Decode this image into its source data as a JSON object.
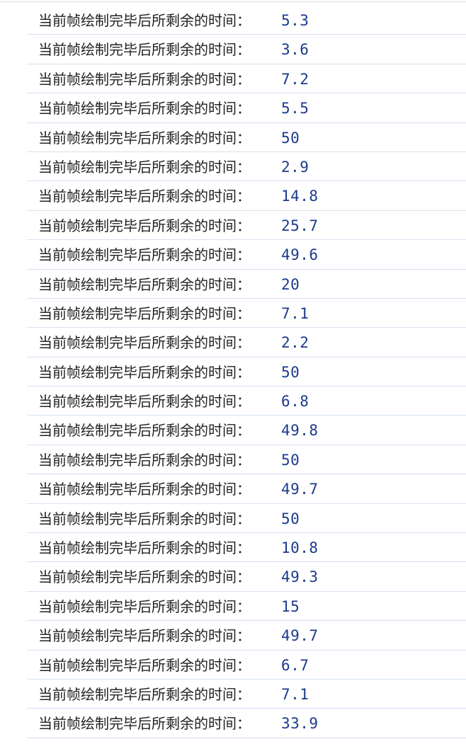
{
  "console": {
    "label": "当前帧绘制完毕后所剩余的时间：",
    "rows": [
      {
        "value": "5.3"
      },
      {
        "value": "3.6"
      },
      {
        "value": "7.2"
      },
      {
        "value": "5.5"
      },
      {
        "value": "50"
      },
      {
        "value": "2.9"
      },
      {
        "value": "14.8"
      },
      {
        "value": "25.7"
      },
      {
        "value": "49.6"
      },
      {
        "value": "20"
      },
      {
        "value": "7.1"
      },
      {
        "value": "2.2"
      },
      {
        "value": "50"
      },
      {
        "value": "6.8"
      },
      {
        "value": "49.8"
      },
      {
        "value": "50"
      },
      {
        "value": "49.7"
      },
      {
        "value": "50"
      },
      {
        "value": "10.8"
      },
      {
        "value": "49.3"
      },
      {
        "value": "15"
      },
      {
        "value": "49.7"
      },
      {
        "value": "6.7"
      },
      {
        "value": "7.1"
      },
      {
        "value": "33.9"
      }
    ]
  }
}
